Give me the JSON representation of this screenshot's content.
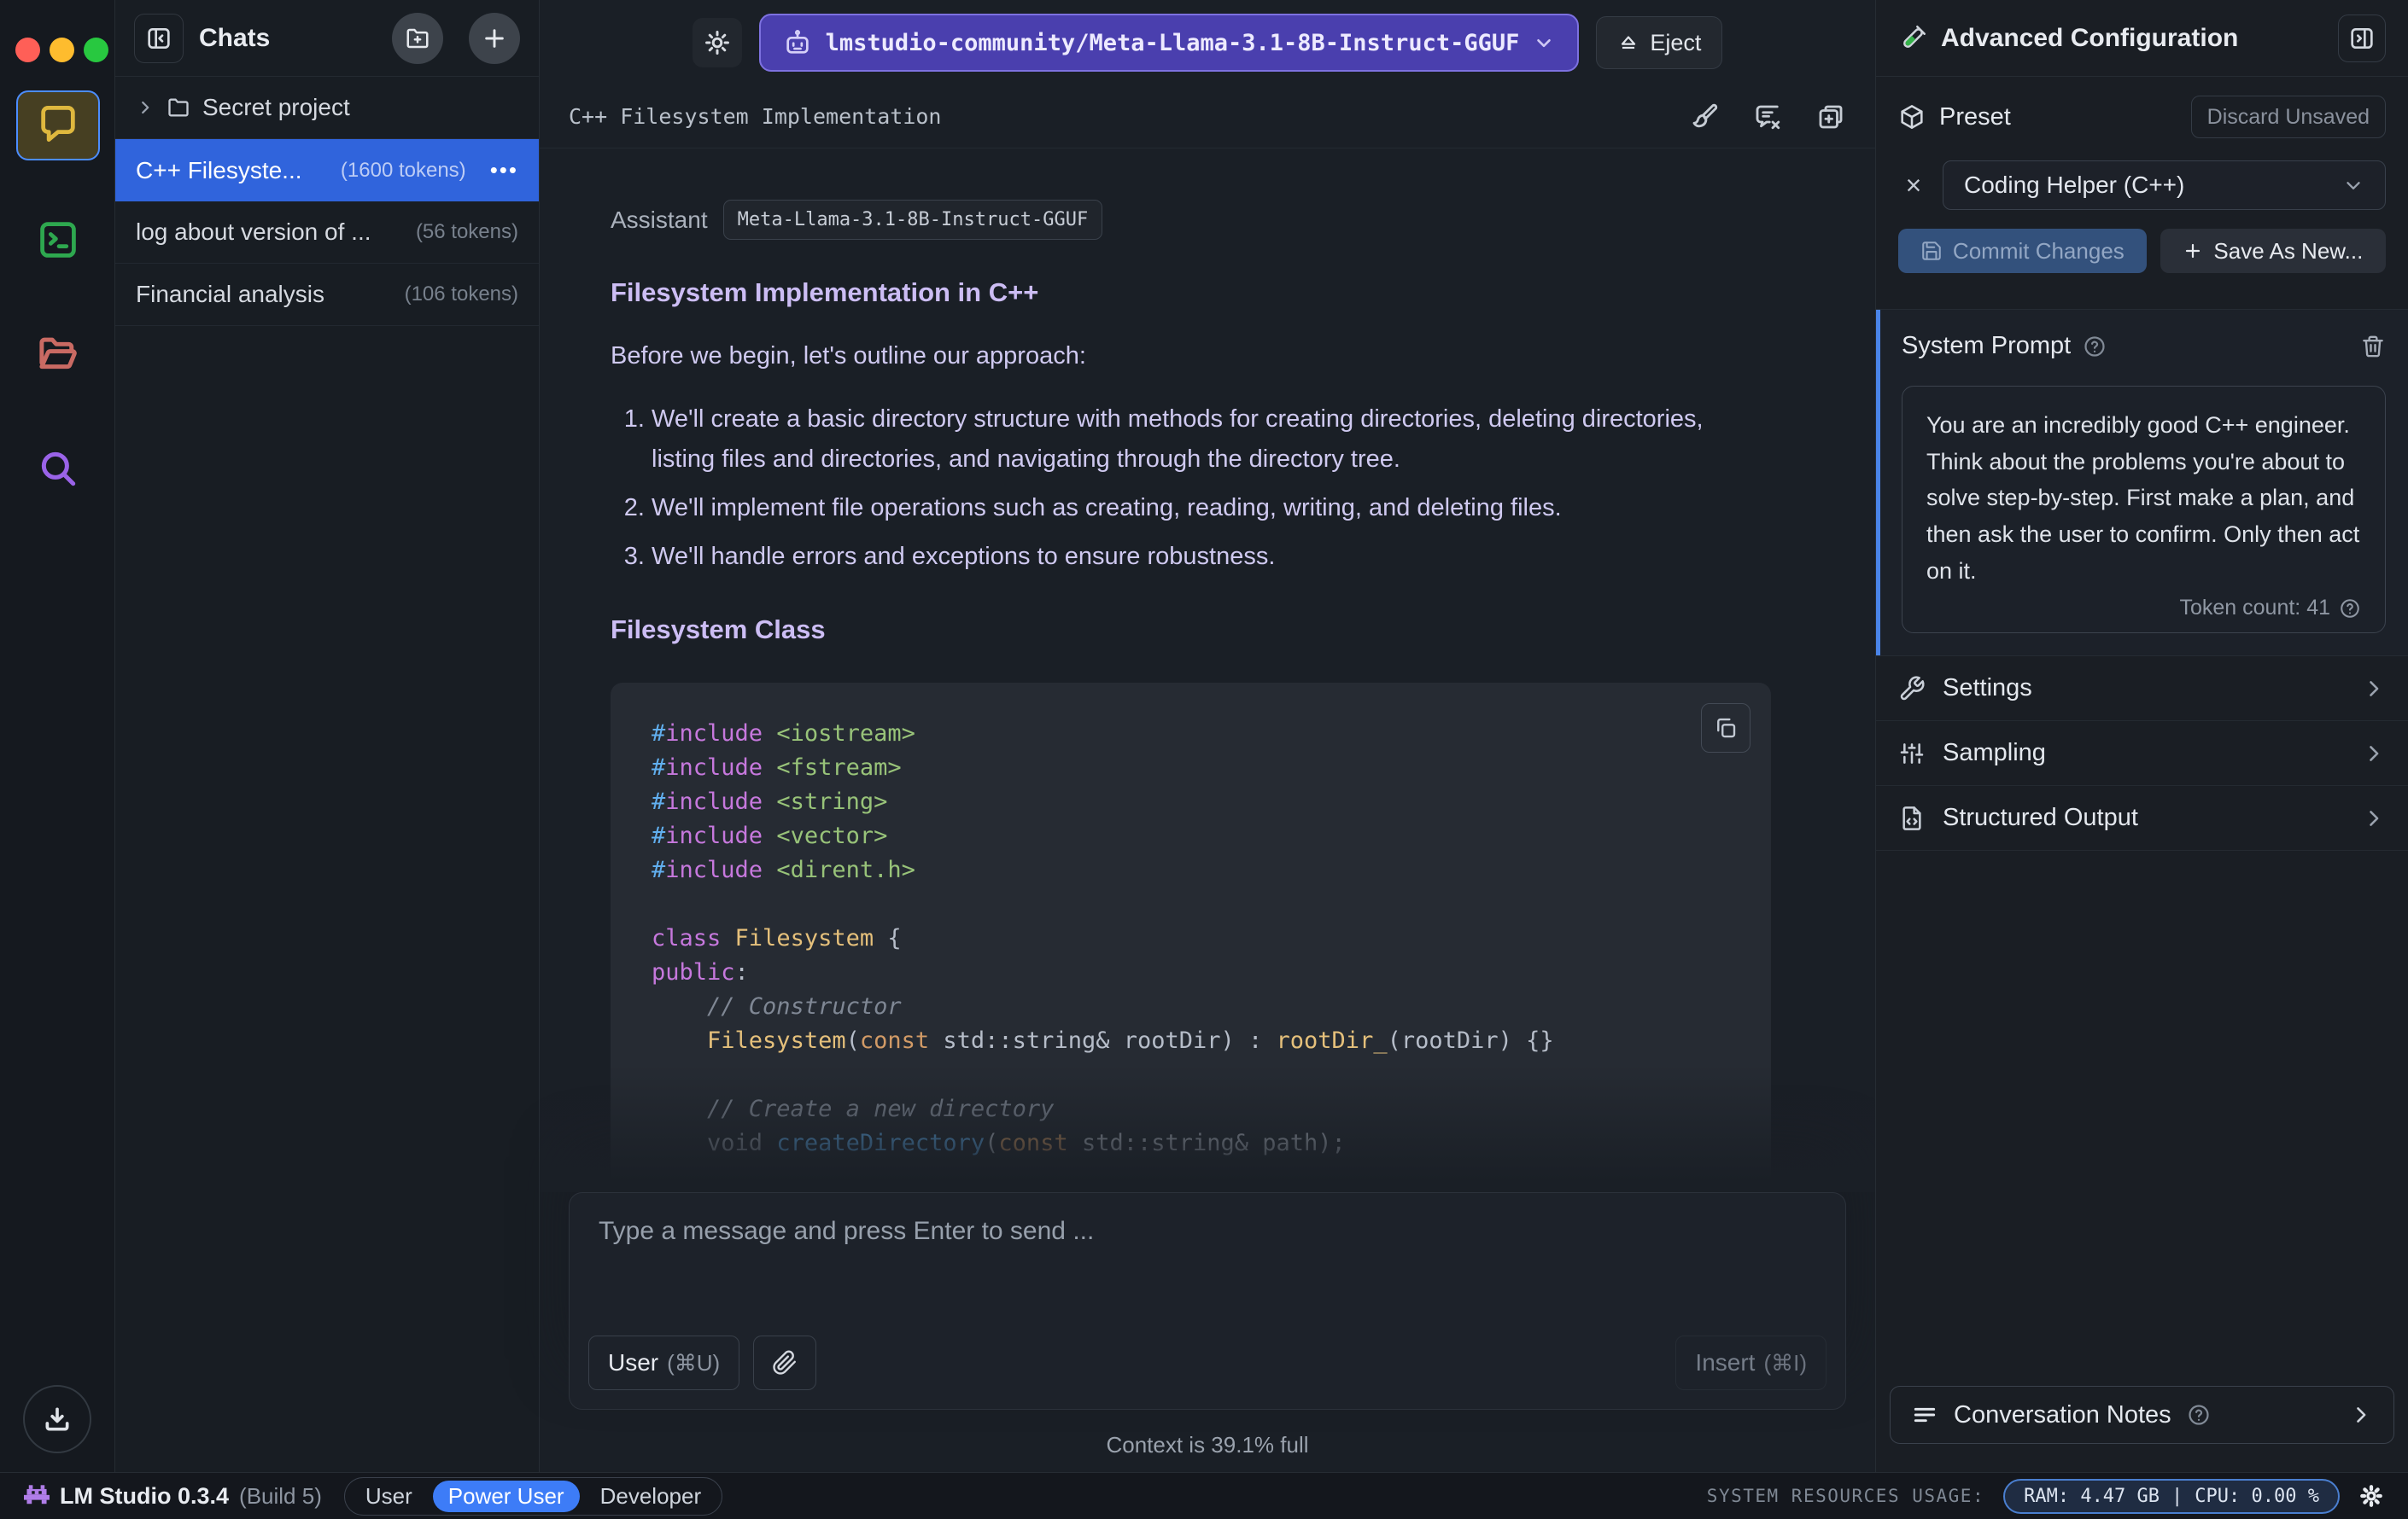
{
  "colors": {
    "selected_chat_bg": "#3064dc",
    "power_user_bg": "#3d7cf7",
    "model_pill_bg": "#4a3fae",
    "model_pill_border": "#7d71e0",
    "system_prompt_accent": "#4a84e8",
    "resource_pill_border": "#4a7fd0",
    "lavender_text": "#cfc9f0"
  },
  "sidebar": {
    "header": "Chats",
    "folder": {
      "name": "Secret project"
    },
    "chats": [
      {
        "title": "C++ Filesyste...",
        "tokens": "(1600 tokens)",
        "menu": "•••"
      },
      {
        "title": "log about version of ...",
        "tokens": "(56 tokens)"
      },
      {
        "title": "Financial analysis",
        "tokens": "(106 tokens)"
      }
    ]
  },
  "topbar": {
    "model": "lmstudio-community/Meta-Llama-3.1-8B-Instruct-GGUF",
    "eject_label": "Eject"
  },
  "chat": {
    "title": "C++ Filesystem Implementation",
    "assistant_label": "Assistant",
    "model_badge": "Meta-Llama-3.1-8B-Instruct-GGUF",
    "heading": "Filesystem Implementation in C++",
    "intro": "Before we begin, let's outline our approach:",
    "approach_items": [
      "We'll create a basic directory structure with methods for creating directories, deleting directories, listing files and directories, and navigating through the directory tree.",
      "We'll implement file operations such as creating, reading, writing, and deleting files.",
      "We'll handle errors and exceptions to ensure robustness."
    ],
    "subheading": "Filesystem Class",
    "code_lines": [
      [
        [
          "hash",
          "#"
        ],
        [
          "kw",
          "include"
        ],
        [
          "pl",
          " "
        ],
        [
          "str",
          "<iostream>"
        ]
      ],
      [
        [
          "hash",
          "#"
        ],
        [
          "kw",
          "include"
        ],
        [
          "pl",
          " "
        ],
        [
          "str",
          "<fstream>"
        ]
      ],
      [
        [
          "hash",
          "#"
        ],
        [
          "kw",
          "include"
        ],
        [
          "pl",
          " "
        ],
        [
          "str",
          "<string>"
        ]
      ],
      [
        [
          "hash",
          "#"
        ],
        [
          "kw",
          "include"
        ],
        [
          "pl",
          " "
        ],
        [
          "str",
          "<vector>"
        ]
      ],
      [
        [
          "hash",
          "#"
        ],
        [
          "kw",
          "include"
        ],
        [
          "pl",
          " "
        ],
        [
          "str",
          "<dirent.h>"
        ]
      ],
      [],
      [
        [
          "kw",
          "class"
        ],
        [
          "pl",
          " "
        ],
        [
          "type",
          "Filesystem"
        ],
        [
          "pl",
          " {"
        ]
      ],
      [
        [
          "kw",
          "public"
        ],
        [
          "pl",
          ":"
        ]
      ],
      [
        [
          "cmt",
          "    // Constructor"
        ]
      ],
      [
        [
          "pl",
          "    "
        ],
        [
          "type",
          "Filesystem"
        ],
        [
          "pl",
          "("
        ],
        [
          "orange",
          "const"
        ],
        [
          "pl",
          " std::string& rootDir) : "
        ],
        [
          "type",
          "rootDir_"
        ],
        [
          "pl",
          "(rootDir) {}"
        ]
      ],
      [],
      [
        [
          "cmt",
          "    // Create a new directory"
        ]
      ],
      [
        [
          "pl",
          "    "
        ],
        [
          "dim",
          "void "
        ],
        [
          "fn",
          "createDirectory"
        ],
        [
          "pl",
          "("
        ],
        [
          "orange",
          "const"
        ],
        [
          "pl",
          " std::string& path);"
        ]
      ]
    ]
  },
  "composer": {
    "placeholder": "Type a message and press Enter to send ...",
    "role_label": "User",
    "role_shortcut": "(⌘U)",
    "insert_label": "Insert",
    "insert_shortcut": "(⌘I)",
    "context_status": "Context is 39.1% full"
  },
  "panel": {
    "title": "Advanced Configuration",
    "preset": {
      "label": "Preset",
      "discard": "Discard Unsaved",
      "value": "Coding Helper (C++)",
      "commit": "Commit Changes",
      "save_new": "Save As New..."
    },
    "system_prompt": {
      "label": "System Prompt",
      "text": "You are an incredibly good C++ engineer. Think about the problems you're about to solve step-by-step. First make a plan, and then ask the user to confirm. Only then act on it.",
      "token_count": "Token count: 41"
    },
    "sections": [
      {
        "label": "Settings"
      },
      {
        "label": "Sampling"
      },
      {
        "label": "Structured Output"
      }
    ],
    "notes": {
      "label": "Conversation Notes"
    }
  },
  "statusbar": {
    "app_name": "LM Studio 0.3.4",
    "build": "(Build 5)",
    "roles": [
      "User",
      "Power User",
      "Developer"
    ],
    "selected_role": "Power User",
    "resources_label": "SYSTEM RESOURCES USAGE:",
    "ram": "RAM: 4.47 GB",
    "separator": "|",
    "cpu": "CPU: 0.00 %"
  }
}
